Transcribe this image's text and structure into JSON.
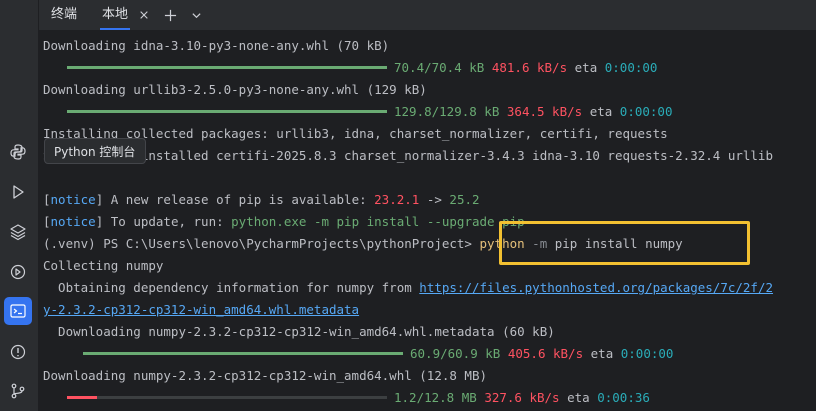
{
  "tabs": {
    "terminal_label": "终端",
    "local_label": "本地"
  },
  "tooltip": {
    "text": "Python 控制台"
  },
  "lines": {
    "l1": "Downloading idna-3.10-py3-none-any.whl (70 kB)",
    "p1_size": "70.4/70.4 kB",
    "p1_speed": "481.6 kB/s",
    "p1_eta_label": "eta",
    "p1_eta": "0:00:00",
    "l2": "Downloading urllib3-2.5.0-py3-none-any.whl (129 kB)",
    "p2_size": "129.8/129.8 kB",
    "p2_speed": "364.5 kB/s",
    "p2_eta_label": "eta",
    "p2_eta": "0:00:00",
    "l3": "Installing collected packages: urllib3, idna, charset_normalizer, certifi, requests",
    "l4": "Successfully installed certifi-2025.8.3 charset_normalizer-3.4.3 idna-3.10 requests-2.32.4 urllib",
    "notice1_tag": "notice",
    "notice1_text": " A new release of pip is available: ",
    "notice1_old": "23.2.1",
    "notice1_arrow": " -> ",
    "notice1_new": "25.2",
    "notice2_tag": "notice",
    "notice2_text": " To update, run: ",
    "notice2_cmd": "python.exe -m pip install --upgrade pip",
    "prompt": "(.venv) PS C:\\Users\\lenovo\\PycharmProjects\\pythonProject> ",
    "cmd_python": "python",
    "cmd_flag": " -m",
    "cmd_rest": " pip install numpy",
    "l5": "Collecting numpy",
    "l6": "  Obtaining dependency information for numpy from ",
    "l6_link": "https://files.pythonhosted.org/packages/7c/2f/2",
    "l7_link": "y-2.3.2-cp312-cp312-win_amd64.whl.metadata",
    "l8": "  Downloading numpy-2.3.2-cp312-cp312-win_amd64.whl.metadata (60 kB)",
    "p3_size": "60.9/60.9 kB",
    "p3_speed": "405.6 kB/s",
    "p3_eta_label": "eta",
    "p3_eta": "0:00:00",
    "l9": "Downloading numpy-2.3.2-cp312-cp312-win_amd64.whl (12.8 MB)",
    "p4_size": "1.2/12.8 MB",
    "p4_speed": "327.6 kB/s",
    "p4_eta_label": "eta",
    "p4_eta": "0:00:36"
  },
  "progress": {
    "p1": 1.0,
    "p2": 1.0,
    "p3": 1.0,
    "p4": 0.094
  },
  "colors": {
    "accent": "#3574f0",
    "progress_done": "#6aab73",
    "progress_active": "#ff5261",
    "highlight": "#f2c031"
  }
}
